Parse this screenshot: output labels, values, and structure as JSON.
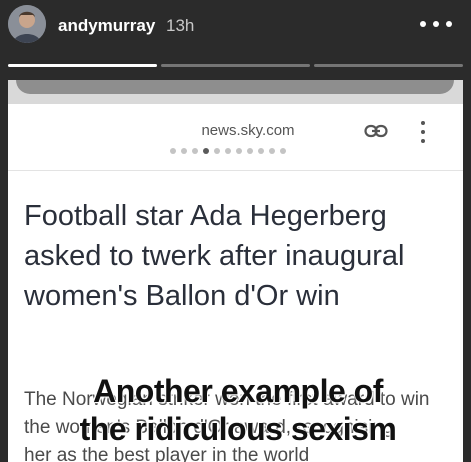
{
  "story": {
    "username": "andymurray",
    "timestamp": "13h",
    "progress_segments": 3,
    "active_segment": 0
  },
  "article": {
    "url": "news.sky.com",
    "headline": "Football star Ada Hegerberg asked to twerk after inaugural women's Ballon d'Or win",
    "body_line1": "The Norwegian striker won the first award to win",
    "body_line2": "the women's Ballon d'Or award, recognising",
    "body_line3": "her as the best player in the world",
    "pager_dots": 11,
    "pager_current": 3
  },
  "caption": {
    "line1": "Another example of",
    "line2": "the ridiculous sexism"
  },
  "colors": {
    "background": "#2b2b2b",
    "headline": "#2a2f3a"
  },
  "icons": {
    "more": "more-horizontal-icon",
    "link": "link-icon",
    "menu": "more-vertical-icon"
  }
}
